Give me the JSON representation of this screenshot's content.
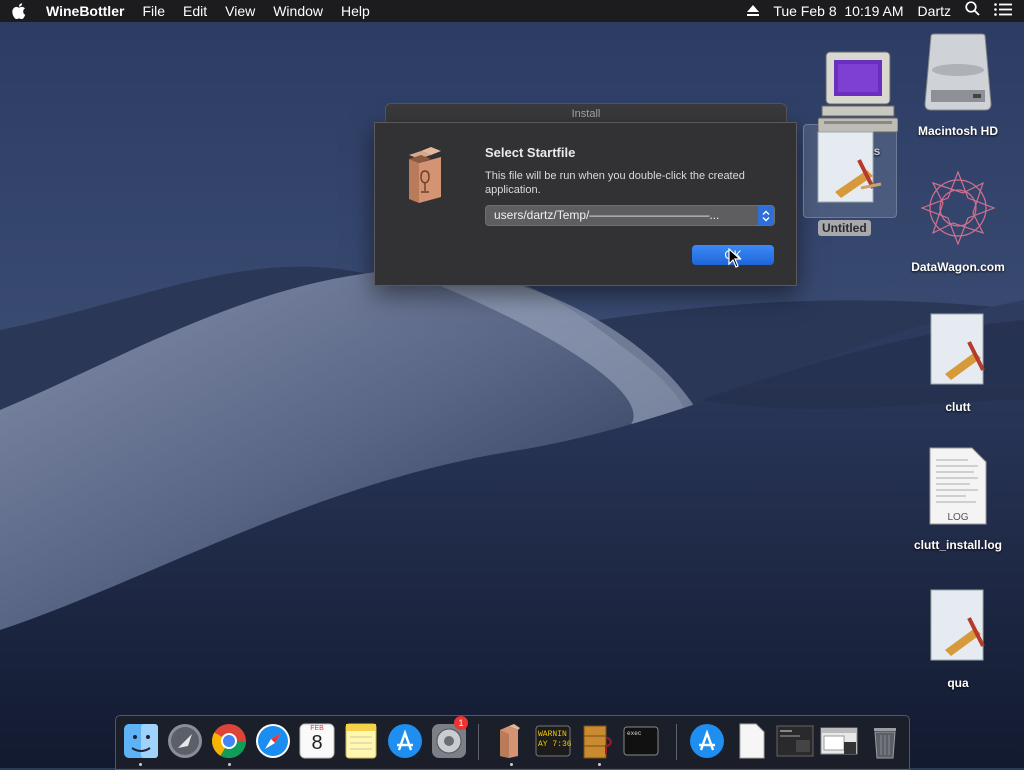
{
  "menubar": {
    "app_name": "WineBottler",
    "menus": [
      "File",
      "Edit",
      "View",
      "Window",
      "Help"
    ],
    "datetime": "Tue Feb 8  10:19 AM",
    "user": "Dartz"
  },
  "dialog": {
    "window_title": "Install",
    "heading": "Select Startfile",
    "description": "This file will be run when you double-click the created application.",
    "startfile_path": "users/dartz/Temp/——————————...",
    "ok_label": "OK"
  },
  "desktop": {
    "icons": [
      {
        "label": "Macintosh HD"
      },
      {
        "label": "DataWagon.com"
      },
      {
        "label": "clutt"
      },
      {
        "label": "clutt_install.log"
      },
      {
        "label": "qua"
      },
      {
        "label": "Untitled"
      }
    ],
    "partial_label": "as",
    "log_icon_text": "LOG"
  },
  "dock": {
    "calendar_month": "FEB",
    "calendar_day": "8",
    "prefs_badge": "1",
    "console_line1": "WARNIN",
    "console_line2": "AY 7:36",
    "terminal_text": "exec"
  },
  "colors": {
    "menubar_bg": "#1c1c1e",
    "dialog_bg": "#323234",
    "accent": "#1e66d8"
  }
}
